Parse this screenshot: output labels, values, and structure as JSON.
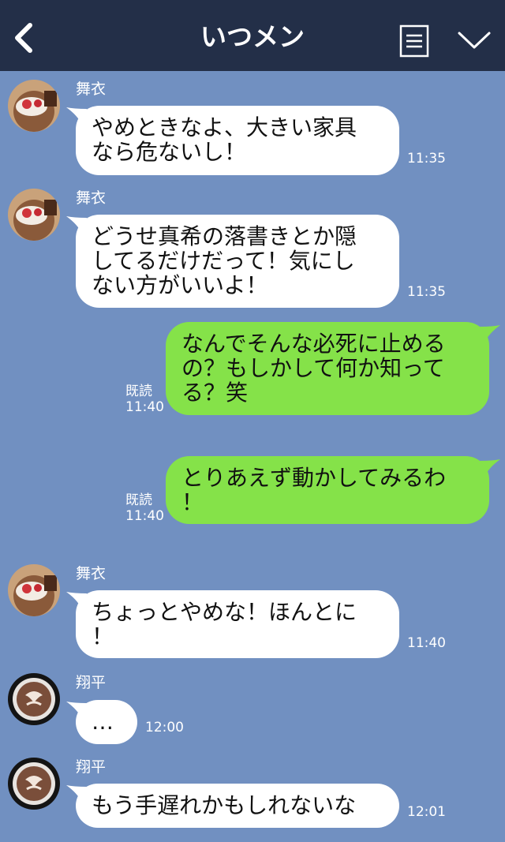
{
  "header": {
    "title": "いつメン",
    "back_icon": "chevron-left-icon",
    "menu_icon": "notes-icon",
    "expand_icon": "chevron-down-icon",
    "background": "#232f48"
  },
  "colors": {
    "chat_background": "#7190c1",
    "incoming_bubble": "#ffffff",
    "outgoing_bubble": "#85e249"
  },
  "messages": [
    {
      "direction": "in",
      "sender": "舞衣",
      "avatar": "cake-avatar",
      "text": "やめときなよ、大きい家具\nなら危ないし！",
      "time": "11:35"
    },
    {
      "direction": "in",
      "sender": "舞衣",
      "avatar": "cake-avatar",
      "text": "どうせ真希の落書きとか隠\nしてるだけだって！気にし\nない方がいいよ！",
      "time": "11:35"
    },
    {
      "direction": "out",
      "read": "既読",
      "text": "なんでそんな必死に止める\nの？もしかして何か知って\nる？笑",
      "time": "11:40"
    },
    {
      "direction": "out",
      "read": "既読",
      "text": "とりあえず動かしてみるわ\n！",
      "time": "11:40"
    },
    {
      "direction": "in",
      "sender": "舞衣",
      "avatar": "cake-avatar",
      "text": "ちょっとやめな！ほんとに\n！",
      "time": "11:40"
    },
    {
      "direction": "in",
      "sender": "翔平",
      "avatar": "latte-avatar",
      "text": "…",
      "time": "12:00"
    },
    {
      "direction": "in",
      "sender": "翔平",
      "avatar": "latte-avatar",
      "text": "もう手遅れかもしれないな",
      "time": "12:01"
    }
  ]
}
